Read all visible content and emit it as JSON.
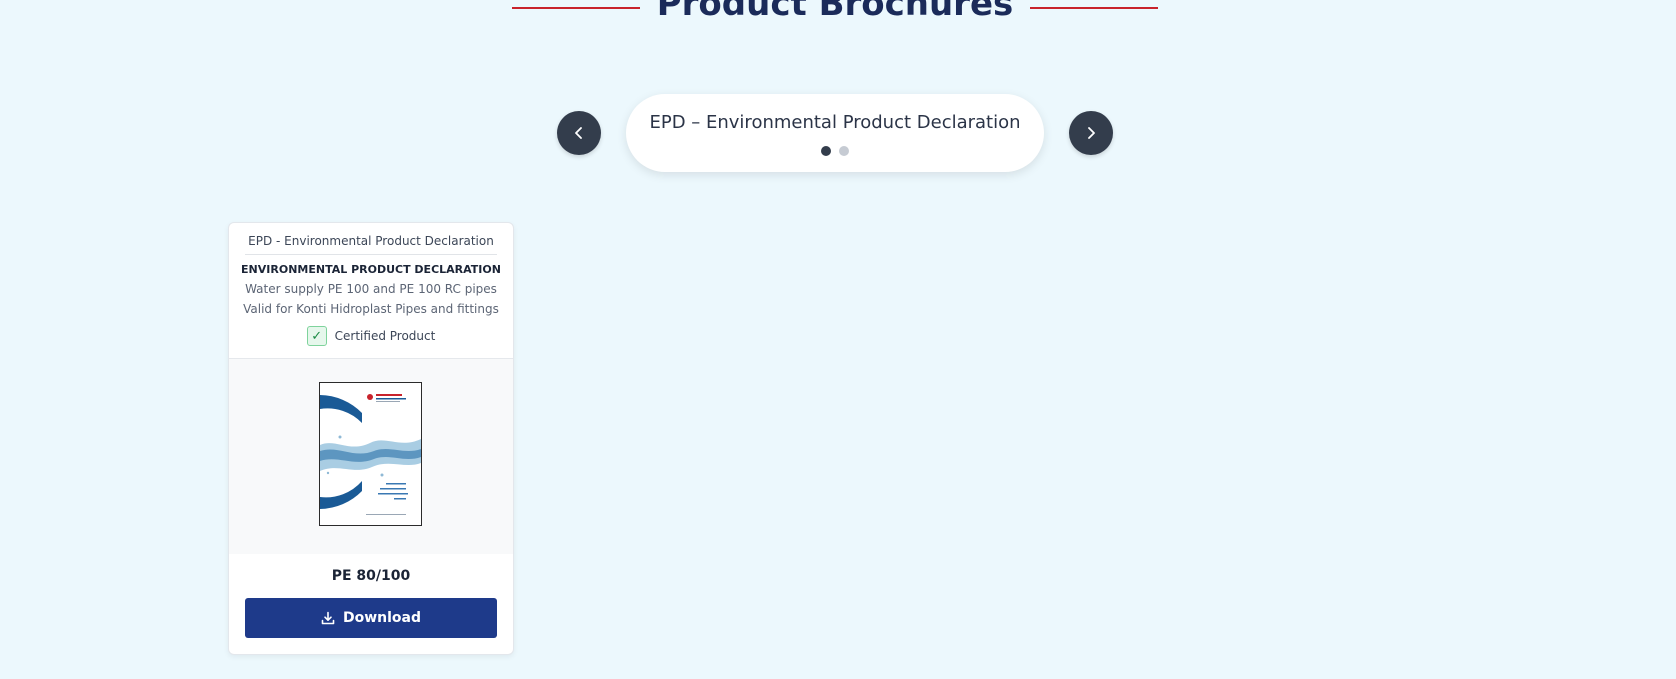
{
  "section": {
    "title": "Product Brochures",
    "accent_color": "#c8232c",
    "title_color": "#1b2b5a"
  },
  "carousel": {
    "title": "EPD – Environmental Product Declaration",
    "prev_icon": "chevron-left-icon",
    "next_icon": "chevron-right-icon",
    "pages": 2,
    "active_page": 1
  },
  "card": {
    "category": "EPD - Environmental Product Declaration",
    "heading": "ENVIRONMENTAL PRODUCT DECLARATION",
    "description_line1": "Water supply PE 100 and PE 100 RC pipes",
    "description_line2": "Valid for Konti Hidroplast Pipes and fittings",
    "certified_label": "Certified Product",
    "certified_icon": "checkmark-icon",
    "thumbnail_icon": "brochure-cover-image",
    "version": "PE 80/100",
    "download_label": "Download",
    "download_icon": "download-icon",
    "button_color": "#1e3a8a"
  }
}
